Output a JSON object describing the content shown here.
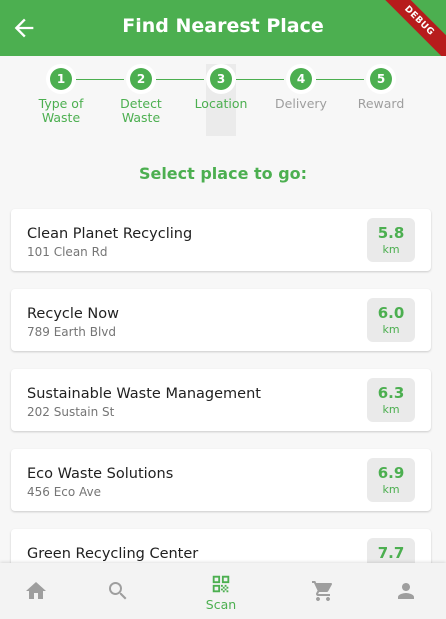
{
  "app_bar": {
    "title": "Find Nearest Place",
    "debug_label": "DEBUG",
    "back_icon": "arrow-back-icon"
  },
  "stepper": {
    "current_step": 3,
    "steps": [
      {
        "number": "1",
        "label": "Type of Waste",
        "state": "complete"
      },
      {
        "number": "2",
        "label": "Detect Waste",
        "state": "complete"
      },
      {
        "number": "3",
        "label": "Location",
        "state": "active"
      },
      {
        "number": "4",
        "label": "Delivery",
        "state": "upcoming"
      },
      {
        "number": "5",
        "label": "Reward",
        "state": "upcoming"
      }
    ]
  },
  "heading": "Select place to go:",
  "places": [
    {
      "name": "Clean Planet Recycling",
      "address": "101 Clean Rd",
      "distance": "5.8",
      "unit": "km"
    },
    {
      "name": "Recycle Now",
      "address": "789 Earth Blvd",
      "distance": "6.0",
      "unit": "km"
    },
    {
      "name": "Sustainable Waste Management",
      "address": "202 Sustain St",
      "distance": "6.3",
      "unit": "km"
    },
    {
      "name": "Eco Waste Solutions",
      "address": "456 Eco Ave",
      "distance": "6.9",
      "unit": "km"
    },
    {
      "name": "Green Recycling Center",
      "address": "",
      "distance": "7.7",
      "unit": "km"
    }
  ],
  "bottom_nav": {
    "items": [
      {
        "icon": "home-icon",
        "label": ""
      },
      {
        "icon": "search-icon",
        "label": ""
      },
      {
        "icon": "qr-code-icon",
        "label": "Scan"
      },
      {
        "icon": "cart-icon",
        "label": ""
      },
      {
        "icon": "person-icon",
        "label": ""
      }
    ]
  },
  "colors": {
    "primary": "#4caf50",
    "debug_ribbon": "#b71c1c",
    "inactive_icon": "#9e9e9e"
  }
}
